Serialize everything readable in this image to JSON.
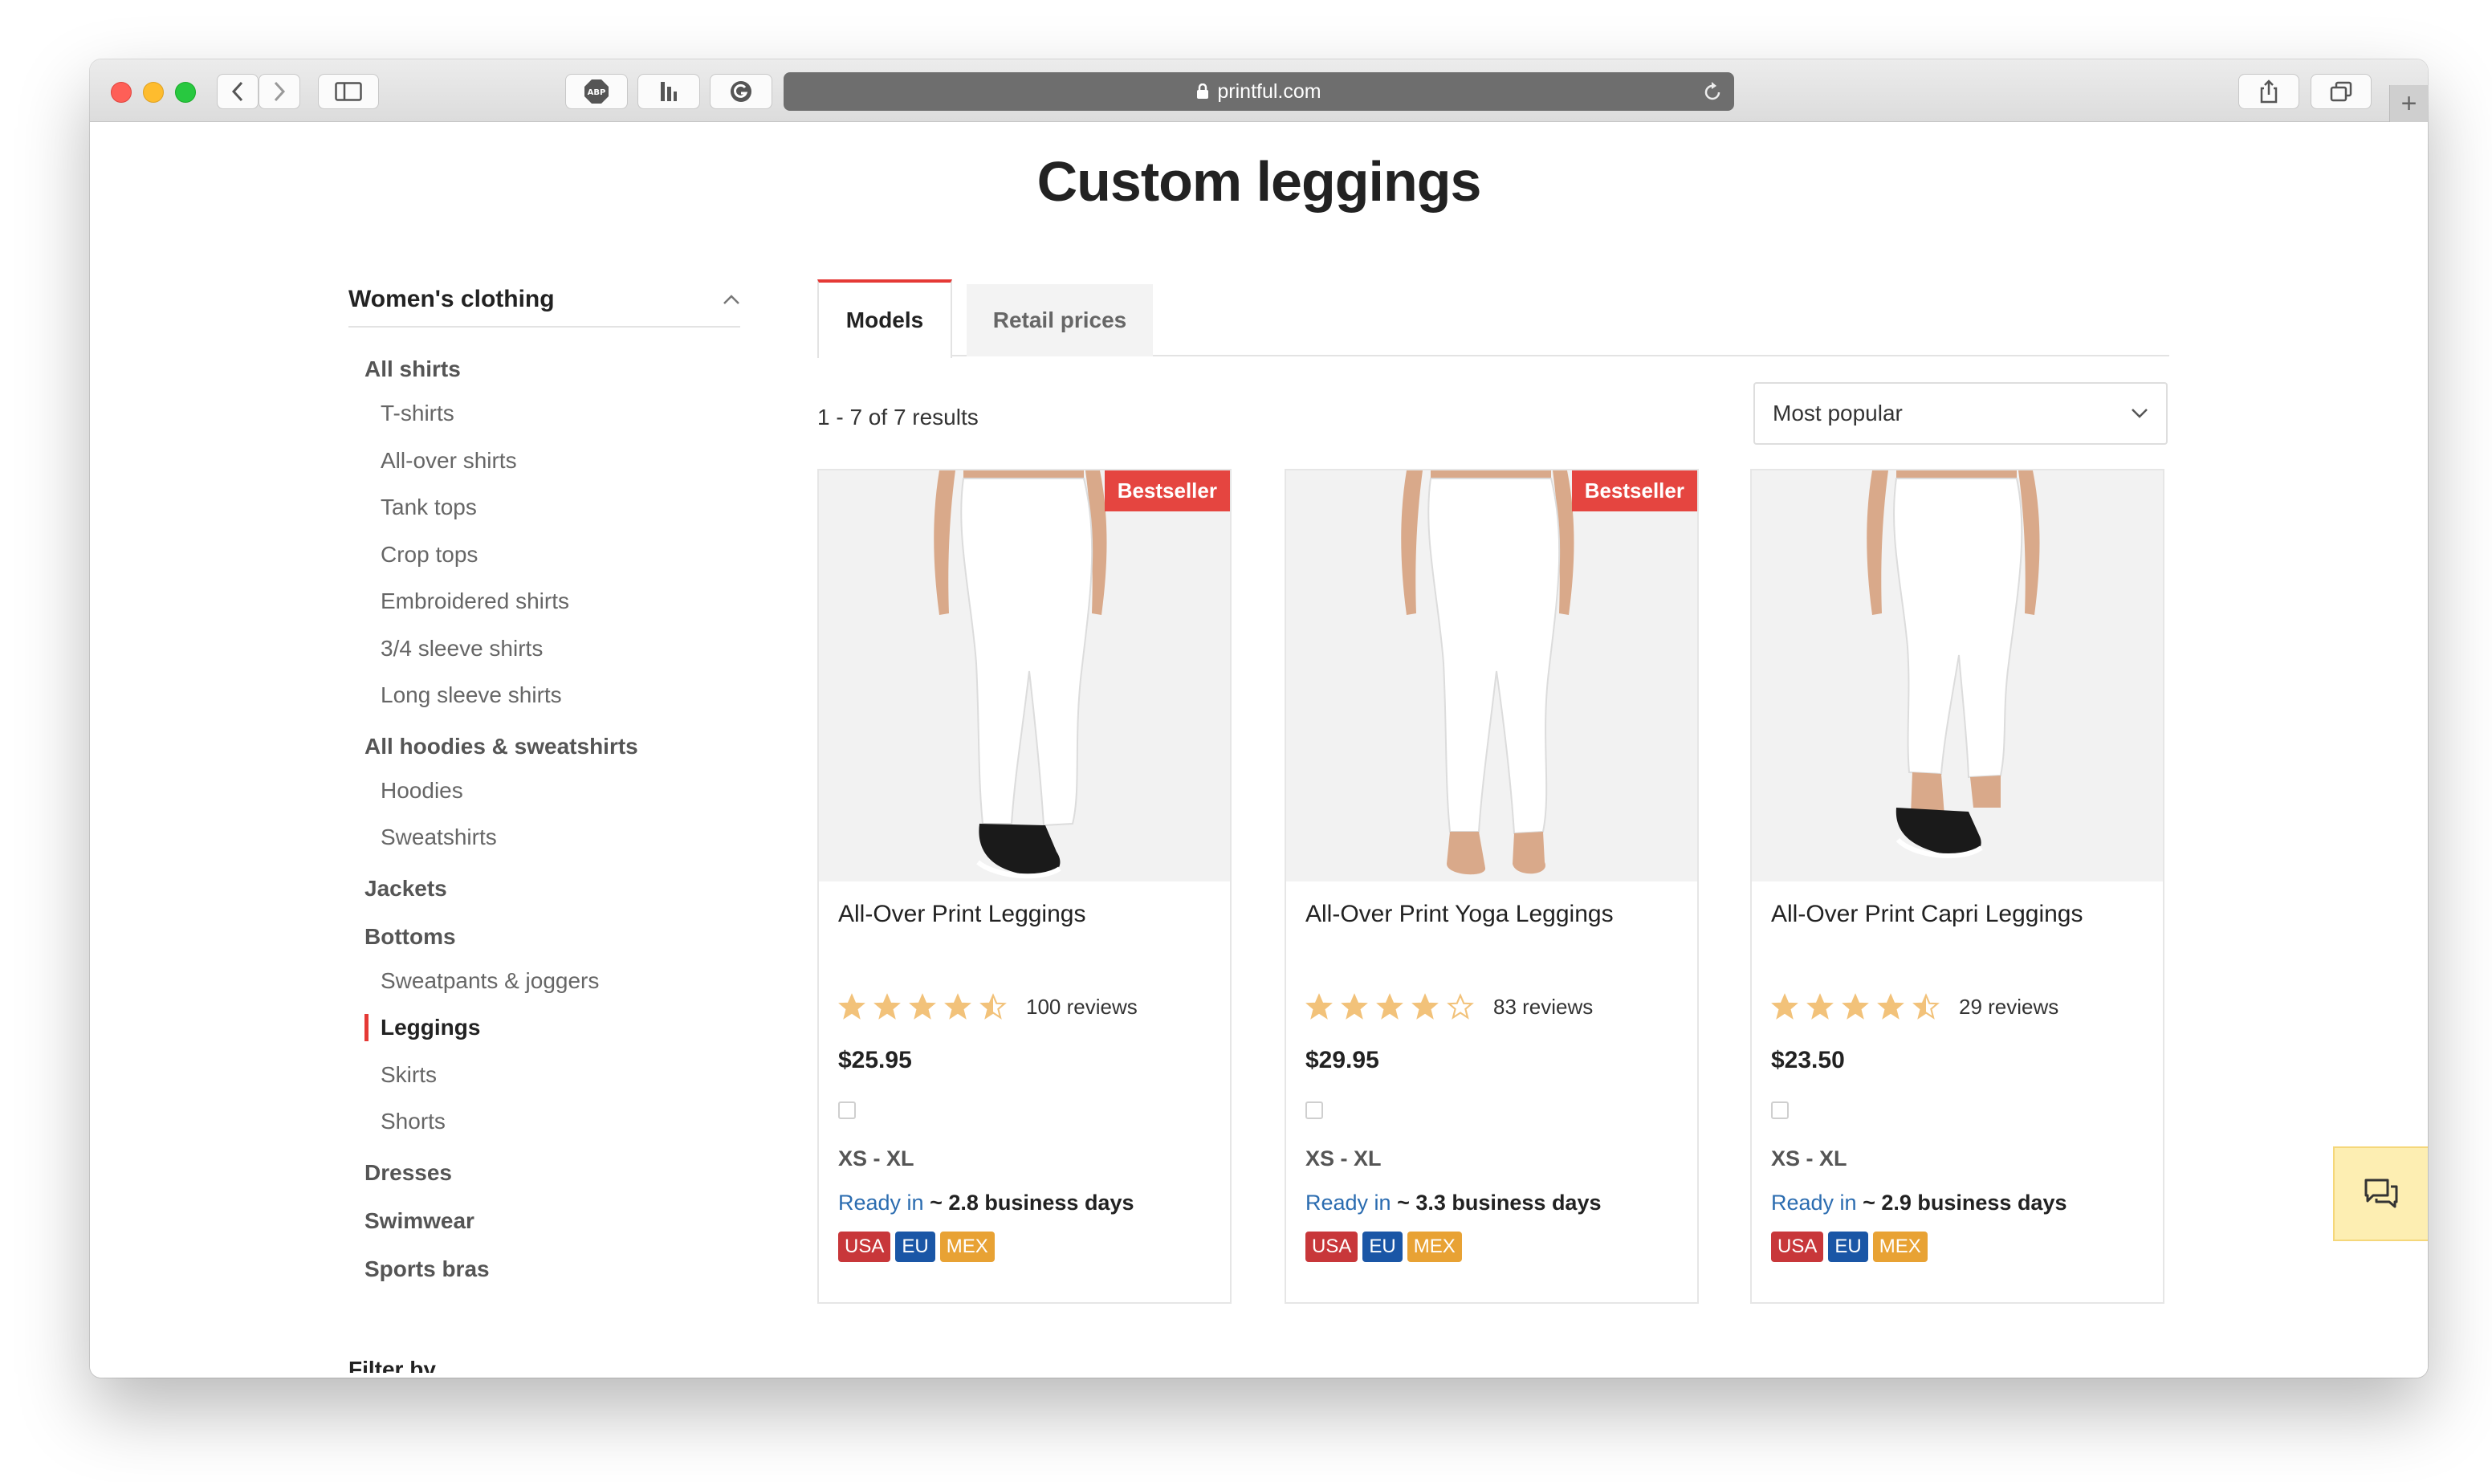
{
  "browser": {
    "url": "printful.com"
  },
  "page": {
    "title": "Custom leggings"
  },
  "sidebar": {
    "header": "Women's clothing",
    "groups": [
      {
        "label": "All shirts",
        "items": [
          "T-shirts",
          "All-over shirts",
          "Tank tops",
          "Crop tops",
          "Embroidered shirts",
          "3/4 sleeve shirts",
          "Long sleeve shirts"
        ]
      },
      {
        "label": "All hoodies & sweatshirts",
        "items": [
          "Hoodies",
          "Sweatshirts"
        ]
      },
      {
        "label": "Jackets",
        "items": []
      },
      {
        "label": "Bottoms",
        "items": [
          "Sweatpants & joggers",
          "Leggings",
          "Skirts",
          "Shorts"
        ]
      },
      {
        "label": "Dresses",
        "items": []
      },
      {
        "label": "Swimwear",
        "items": []
      },
      {
        "label": "Sports bras",
        "items": []
      }
    ],
    "active_item": "Leggings",
    "partial_section_label": "Filter by"
  },
  "tabs": [
    {
      "label": "Models",
      "active": true
    },
    {
      "label": "Retail prices",
      "active": false
    }
  ],
  "results": {
    "count_text": "1 - 7 of 7 results",
    "sort_selected": "Most popular"
  },
  "products": [
    {
      "badge": "Bestseller",
      "name": "All-Over Print Leggings",
      "rating": 4.5,
      "reviews": "100 reviews",
      "price": "$25.95",
      "sizes": "XS - XL",
      "ready_label": "Ready in",
      "ready_value": "~ 2.8 business days",
      "regions": [
        "USA",
        "EU",
        "MEX"
      ]
    },
    {
      "badge": "Bestseller",
      "name": "All-Over Print Yoga Leggings",
      "rating": 4,
      "reviews": "83 reviews",
      "price": "$29.95",
      "sizes": "XS - XL",
      "ready_label": "Ready in",
      "ready_value": "~ 3.3 business days",
      "regions": [
        "USA",
        "EU",
        "MEX"
      ]
    },
    {
      "badge": "",
      "name": "All-Over Print Capri Leggings",
      "rating": 4.5,
      "reviews": "29 reviews",
      "price": "$23.50",
      "sizes": "XS - XL",
      "ready_label": "Ready in",
      "ready_value": "~ 2.9 business days",
      "regions": [
        "USA",
        "EU",
        "MEX"
      ]
    }
  ],
  "colors": {
    "accent": "#e53935",
    "badge": "#e54540",
    "star": "#f2c27a",
    "link": "#2b6cb0",
    "region_usa": "#c8373a",
    "region_eu": "#1a56a6",
    "region_mex": "#e8a234",
    "chat_bg": "#fdeeb2"
  },
  "icons": {
    "toolbar": [
      "back-icon",
      "forward-icon",
      "sidebar-icon",
      "adblock-icon",
      "extension-icon",
      "grammarly-icon",
      "lock-icon",
      "reload-icon",
      "share-icon",
      "tabs-icon",
      "plus-icon"
    ],
    "chat": "chat-icon",
    "sort": "chevron-down-icon",
    "sidebar_collapse": "chevron-up-icon"
  }
}
